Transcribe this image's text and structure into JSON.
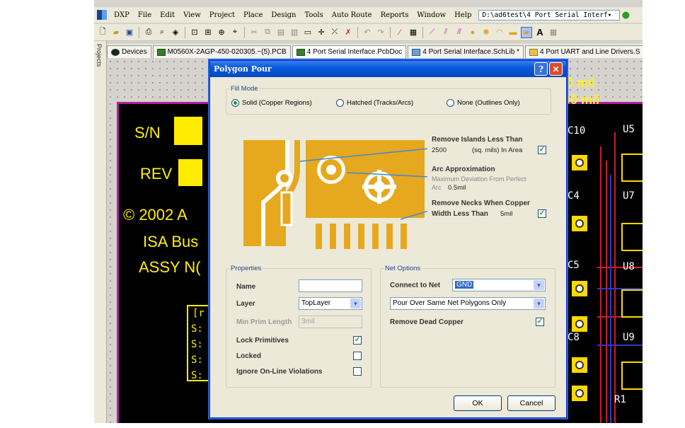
{
  "menubar": {
    "items": [
      "DXP",
      "File",
      "Edit",
      "View",
      "Project",
      "Place",
      "Design",
      "Tools",
      "Auto Route",
      "Reports",
      "Window",
      "Help"
    ],
    "path": "D:\\ad6test\\4 Port Serial Interf▾"
  },
  "projects_panel": {
    "label": "Projects"
  },
  "tabs": [
    {
      "label": "Devices",
      "icon": "devices-icon"
    },
    {
      "label": "M0560X-2AGP-450-020305.~(5).PCB",
      "icon": "pcb-icon"
    },
    {
      "label": "4 Port Serial Interface.PcbDoc",
      "icon": "pcb-icon"
    },
    {
      "label": "4 Port Serial Interface.SchLib *",
      "icon": "schlib-icon"
    },
    {
      "label": "4 Port UART and Line Drivers.S",
      "icon": "folder-icon"
    }
  ],
  "board": {
    "silk": [
      "S/N",
      "REV",
      "© 2002 A",
      "ISA Bus",
      "ASSY N("
    ],
    "bracket": [
      "[r",
      "S:",
      "S:",
      "S:",
      "S:"
    ],
    "mil1": "0 mil",
    "mil2": "00 mil",
    "refs": [
      "C10",
      "U5",
      "C4",
      "U7",
      "C5",
      "U8",
      "C8",
      "U9",
      "R1"
    ]
  },
  "dialog": {
    "title": "Polygon Pour",
    "help": "?",
    "close": "✕",
    "fill_mode": {
      "legend": "Fill Mode",
      "options": [
        "Solid (Copper Regions)",
        "Hatched (Tracks/Arcs)",
        "None (Outlines Only)"
      ],
      "selected": 0
    },
    "islands": {
      "label": "Remove Islands Less Than",
      "value": "2500",
      "unit": "(sq. mils)  In Area",
      "checked": true
    },
    "arc": {
      "label": "Arc Approximation",
      "desc1": "Maximum Deviation From Perfect",
      "desc2": "Arc",
      "value": "0.5mil"
    },
    "necks": {
      "label1": "Remove Necks When Copper",
      "label2": "Width Less Than",
      "value": "5mil",
      "checked": true
    },
    "properties": {
      "legend": "Properties",
      "name_label": "Name",
      "name_value": "",
      "layer_label": "Layer",
      "layer_value": "TopLayer",
      "minprim_label": "Min Prim Length",
      "minprim_value": "3mil",
      "lock_prims_label": "Lock Primitives",
      "lock_prims": true,
      "locked_label": "Locked",
      "locked": false,
      "ignore_label": "Ignore On-Line Violations",
      "ignore": false
    },
    "net_options": {
      "legend": "Net Options",
      "connect_label": "Connect to Net",
      "connect_value": "GND",
      "pour_value": "Pour Over Same Net Polygons Only",
      "dead_label": "Remove Dead Copper",
      "dead": true
    },
    "ok": "OK",
    "cancel": "Cancel"
  },
  "colors": {
    "copper": "#e6a81e",
    "silk": "#fff100",
    "board": "#000000",
    "outline": "#b020a0",
    "title": "#0a5bd8"
  }
}
